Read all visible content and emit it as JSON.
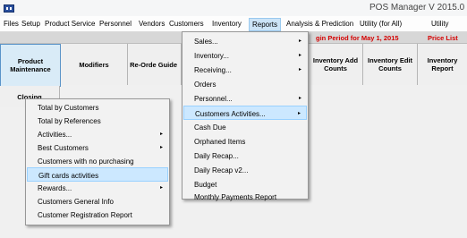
{
  "window": {
    "title": "POS Manager V 2015.0"
  },
  "menubar": {
    "items": [
      {
        "label": "Files"
      },
      {
        "label": "Setup"
      },
      {
        "label": "Product Service"
      },
      {
        "label": "Personnel"
      },
      {
        "label": "Vendors"
      },
      {
        "label": "Customers"
      },
      {
        "label": "Inventory"
      },
      {
        "label": "Reports"
      },
      {
        "label": "Analysis & Prediction"
      },
      {
        "label": "Utility (for All)"
      },
      {
        "label": "Utility"
      }
    ]
  },
  "datebar": {
    "period": "gin Period for  May 1, 2015",
    "price_list": "Price List"
  },
  "toolbar": {
    "buttons": [
      {
        "label": "Product Maintenance"
      },
      {
        "label": "Modifiers"
      },
      {
        "label": "Re-Orde Guide"
      },
      {
        "label": "Inventory Add Counts"
      },
      {
        "label": "Inventory Edit Counts"
      },
      {
        "label": "Inventory Report"
      }
    ],
    "row2": [
      {
        "label": "Closing"
      }
    ]
  },
  "reports_menu": {
    "items": [
      {
        "label": "Sales...",
        "submenu": true
      },
      {
        "label": "Inventory...",
        "submenu": true
      },
      {
        "label": "Receiving...",
        "submenu": true
      },
      {
        "label": "Orders",
        "submenu": false
      },
      {
        "label": "Personnel...",
        "submenu": true
      },
      {
        "label": "Customers Activities...",
        "submenu": true
      },
      {
        "label": "Cash Due",
        "submenu": false
      },
      {
        "label": "Orphaned Items",
        "submenu": false
      },
      {
        "label": "Daily Recap...",
        "submenu": false
      },
      {
        "label": "Daily Recap v2...",
        "submenu": false
      },
      {
        "label": "Budget",
        "submenu": false
      },
      {
        "label": "Monthly Payments Report",
        "submenu": false
      }
    ],
    "highlighted": "Customers Activities..."
  },
  "customers_submenu": {
    "items": [
      {
        "label": "Total by Customers",
        "submenu": false
      },
      {
        "label": "Total by References",
        "submenu": false
      },
      {
        "label": "Activities...",
        "submenu": true
      },
      {
        "label": "Best Customers",
        "submenu": true
      },
      {
        "label": "Customers with no purchasing",
        "submenu": false
      },
      {
        "label": "Gift cards activities",
        "submenu": false
      },
      {
        "label": "Rewards...",
        "submenu": true
      },
      {
        "label": "Customers General Info",
        "submenu": false
      },
      {
        "label": "Customer Registration Report",
        "submenu": false
      }
    ],
    "highlighted": "Gift cards activities"
  },
  "icons": {
    "arrow": "▸"
  },
  "colors": {
    "period_text": "#d40000",
    "highlight": "#cce8ff"
  }
}
